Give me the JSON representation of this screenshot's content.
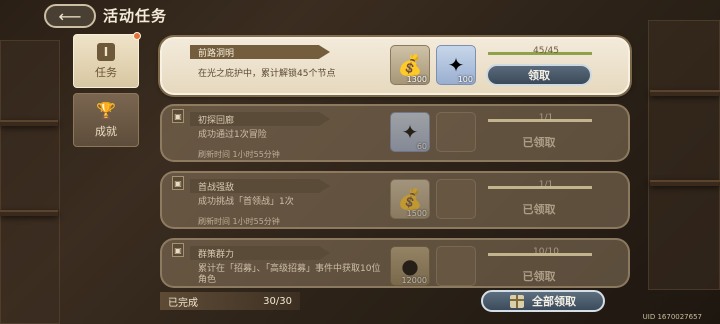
{
  "header": {
    "back_glyph": "⟵",
    "title": "活动任务"
  },
  "tabs": [
    {
      "label": "任务",
      "glyph": "I",
      "active": true,
      "has_badge": true
    },
    {
      "label": "成就",
      "glyph": "🏆",
      "active": false,
      "has_badge": false
    }
  ],
  "tasks": [
    {
      "title": "前路洞明",
      "desc": "在光之庇护中，累计解锁45个节点",
      "time": "",
      "rewards": [
        {
          "type": "bag",
          "qty": "1300"
        },
        {
          "type": "gem",
          "qty": "100"
        }
      ],
      "progress_text": "45/45",
      "progress": 1.0,
      "state": "claimable",
      "button": "领取"
    },
    {
      "title": "初探回廊",
      "desc": "成功通过1次冒险",
      "time": "刷新时间 1小时55分钟",
      "rewards": [
        {
          "type": "gem",
          "qty": "60"
        },
        {
          "type": "empty",
          "qty": ""
        }
      ],
      "progress_text": "1/1",
      "progress": 1.0,
      "state": "claimed",
      "button": "已领取"
    },
    {
      "title": "首战强敌",
      "desc": "成功挑战「首领战」1次",
      "time": "刷新时间 1小时55分钟",
      "rewards": [
        {
          "type": "bag",
          "qty": "1500"
        },
        {
          "type": "empty",
          "qty": ""
        }
      ],
      "progress_text": "1/1",
      "progress": 1.0,
      "state": "claimed",
      "button": "已领取"
    },
    {
      "title": "群策群力",
      "desc": "累计在「招募」、「高级招募」事件中获取10位角色",
      "time": "",
      "rewards": [
        {
          "type": "coin",
          "qty": "12000"
        },
        {
          "type": "empty",
          "qty": ""
        }
      ],
      "progress_text": "10/10",
      "progress": 1.0,
      "state": "claimed",
      "button": "已领取"
    }
  ],
  "footer": {
    "completed_label": "已完成",
    "completed_count": "30/30",
    "claim_all": "全部领取",
    "uid": "UID 1670027657"
  },
  "colors": {
    "accent_button": "#3b4a59",
    "progress_fill": "#8fa24a",
    "badge": "#e2733a"
  }
}
